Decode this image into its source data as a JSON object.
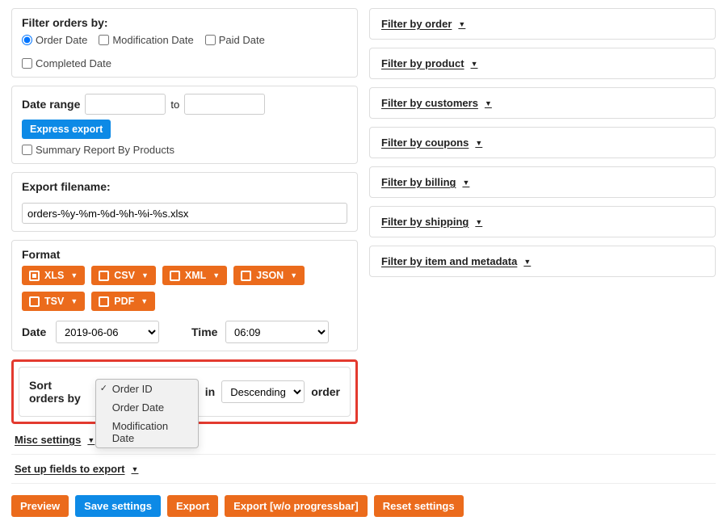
{
  "filter_panel": {
    "title": "Filter orders by:",
    "options": {
      "order_date": "Order Date",
      "modification_date": "Modification Date",
      "paid_date": "Paid Date",
      "completed_date": "Completed Date"
    }
  },
  "date_range": {
    "label": "Date range",
    "to": "to",
    "express_export": "Express export",
    "summary_label": "Summary Report By Products"
  },
  "filename_panel": {
    "title": "Export filename:",
    "value": "orders-%y-%m-%d-%h-%i-%s.xlsx"
  },
  "format_panel": {
    "title": "Format",
    "formats": {
      "xls": "XLS",
      "csv": "CSV",
      "xml": "XML",
      "json": "JSON",
      "tsv": "TSV",
      "pdf": "PDF"
    },
    "date_label": "Date",
    "date_value": "2019-06-06",
    "time_label": "Time",
    "time_value": "06:09"
  },
  "sort_panel": {
    "label_pre": "Sort orders by",
    "label_in": "in",
    "label_order": "order",
    "direction": "Descending",
    "options": {
      "order_id": "Order ID",
      "order_date": "Order Date",
      "modification_date": "Modification Date"
    }
  },
  "misc": {
    "label": "Misc settings"
  },
  "right_filters": {
    "order": "Filter by order",
    "product": "Filter by product",
    "customers": "Filter by customers",
    "coupons": "Filter by coupons",
    "billing": "Filter by billing",
    "shipping": "Filter by shipping",
    "item_meta": "Filter by item and metadata"
  },
  "setup_fields": {
    "label": "Set up fields to export"
  },
  "buttons": {
    "preview": "Preview",
    "save": "Save settings",
    "export": "Export",
    "export_noprog": "Export [w/o progressbar]",
    "reset": "Reset settings"
  }
}
